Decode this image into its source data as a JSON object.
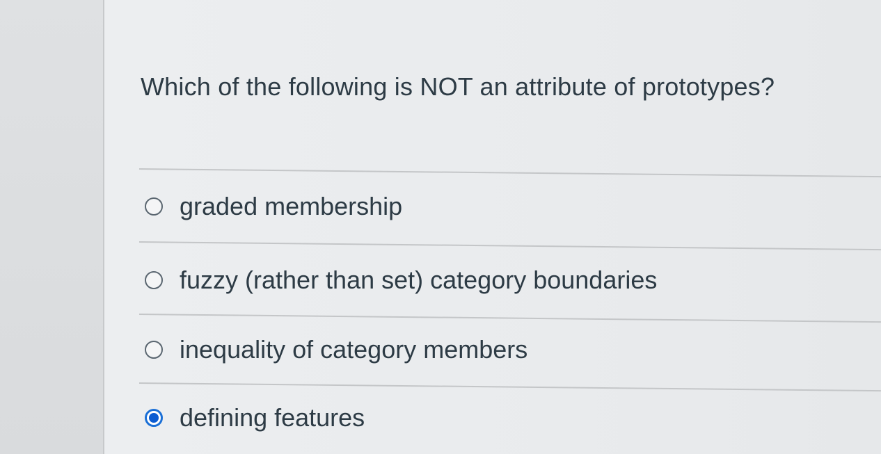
{
  "question": {
    "text": "Which of the following is NOT an attribute of prototypes?"
  },
  "answers": [
    {
      "label": "graded membership",
      "selected": false
    },
    {
      "label": "fuzzy (rather than set) category boundaries",
      "selected": false
    },
    {
      "label": "inequality of category members",
      "selected": false
    },
    {
      "label": "defining features",
      "selected": true
    }
  ],
  "colors": {
    "text": "#2d3b45",
    "radio_selected": "#0b5cd1"
  }
}
